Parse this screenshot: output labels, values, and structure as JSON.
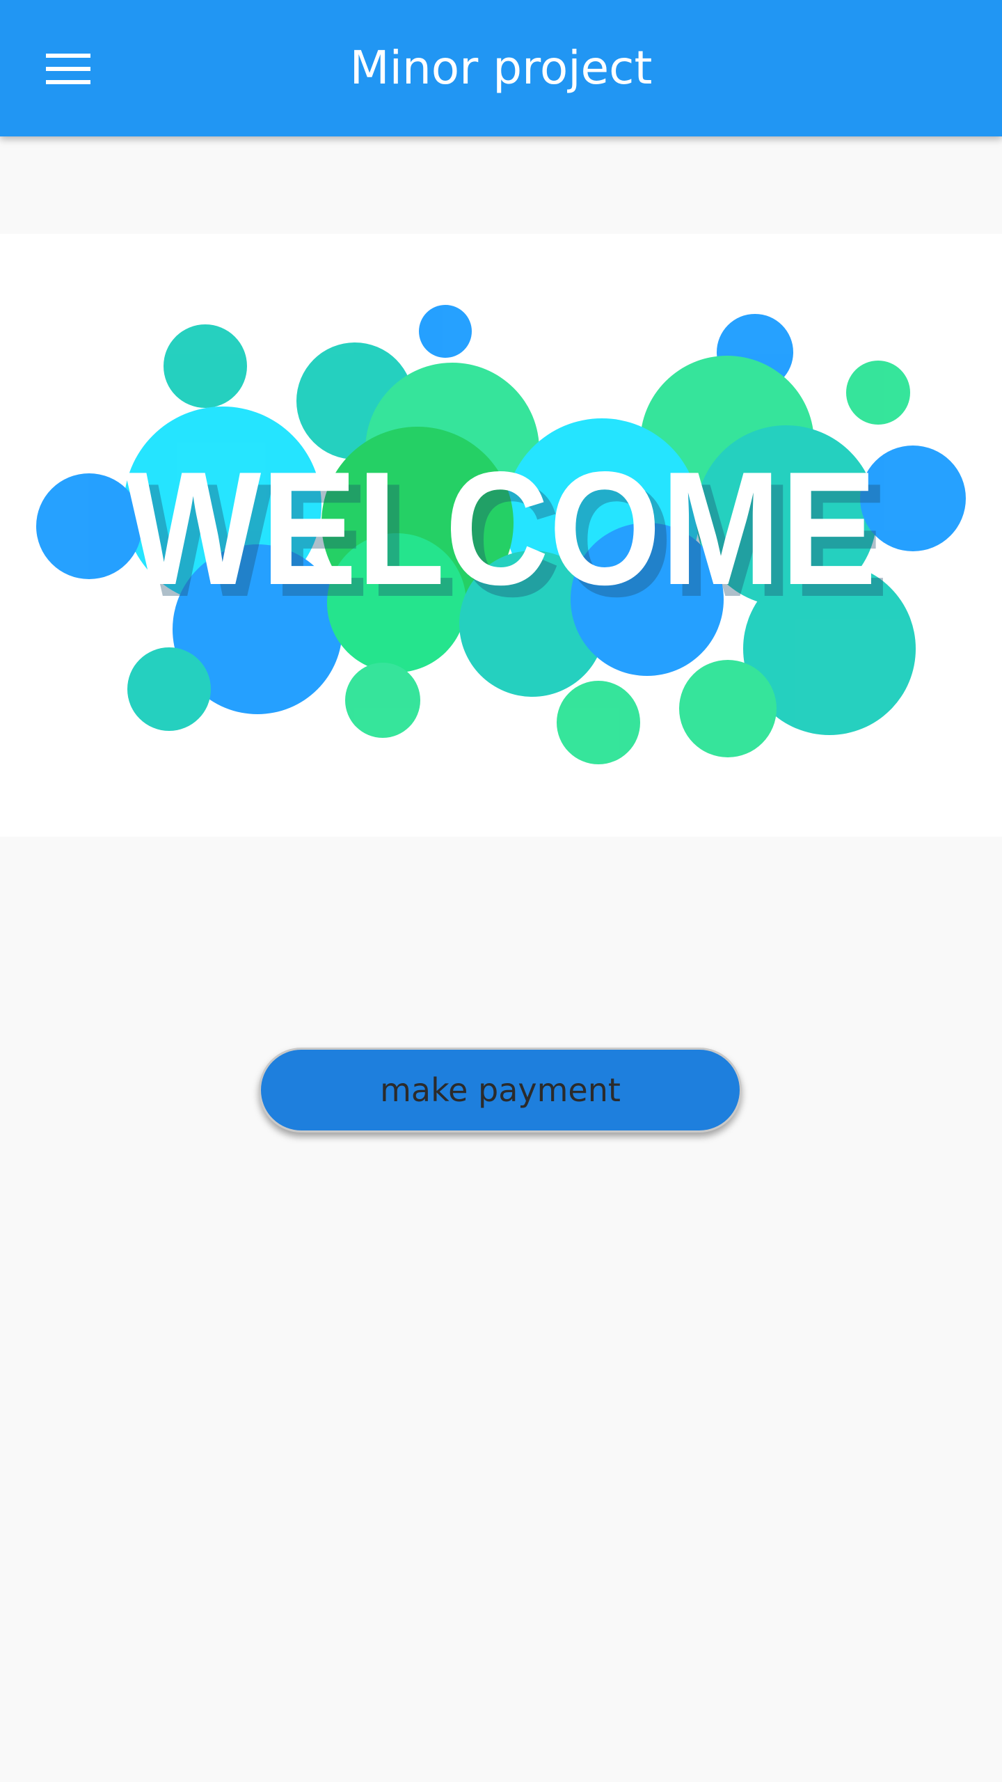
{
  "app_bar": {
    "title": "Minor project",
    "menu_icon": "menu-icon",
    "color": "#2196f3"
  },
  "banner": {
    "text": "WELCOME",
    "colors": [
      "#0090ff",
      "#00c8b4",
      "#00e0ff",
      "#13e08a"
    ]
  },
  "actions": {
    "make_payment_label": "make payment",
    "button_color": "#1e7fdd"
  }
}
